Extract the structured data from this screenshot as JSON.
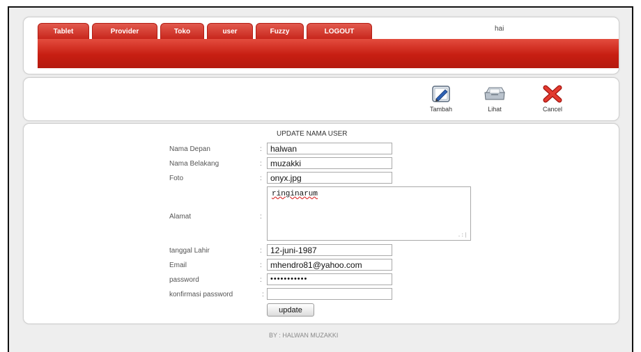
{
  "nav": {
    "tabs": [
      {
        "label": "Tablet"
      },
      {
        "label": "Provider"
      },
      {
        "label": "Toko"
      },
      {
        "label": "user"
      },
      {
        "label": "Fuzzy"
      },
      {
        "label": "LOGOUT"
      }
    ],
    "greeting": "hai"
  },
  "toolbar": {
    "tambah": "Tambah",
    "lihat": "Lihat",
    "cancel": "Cancel"
  },
  "form": {
    "title": "UPDATE NAMA USER",
    "nama_depan": {
      "label": "Nama Depan",
      "value": "halwan"
    },
    "nama_belakang": {
      "label": "Nama Belakang",
      "value": "muzakki"
    },
    "foto": {
      "label": "Foto",
      "value": "onyx.jpg"
    },
    "alamat": {
      "label": "Alamat",
      "value": "ringinarum"
    },
    "tanggal_lahir": {
      "label": "tanggal Lahir",
      "value": "12-juni-1987"
    },
    "email": {
      "label": "Email",
      "value": "mhendro81@yahoo.com"
    },
    "password": {
      "label": "password",
      "value": "•••••••••••"
    },
    "konfirmasi_password": {
      "label": "konfirmasi password",
      "value": ""
    },
    "submit_label": "update"
  },
  "footer": "BY : HALWAN MUZAKKI"
}
